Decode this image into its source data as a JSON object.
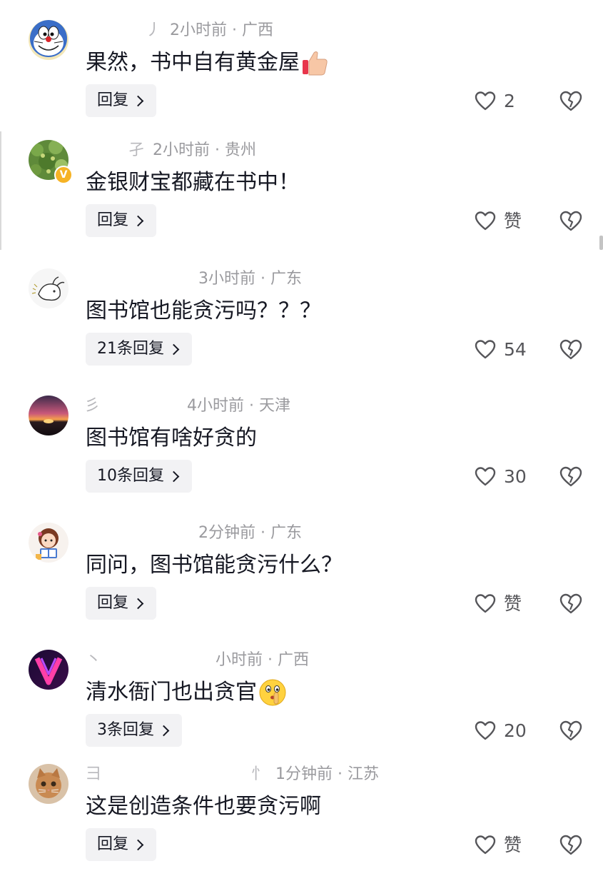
{
  "comments": [
    {
      "name": "",
      "name_fragment": "丿",
      "time": "2小时前",
      "location": "广西",
      "text": "果然，书中自有黄金屋",
      "emoji": "thumbs-up-emoji",
      "reply_label": "回复",
      "likes": "2",
      "avatar_icon": "cartoon-cat-avatar"
    },
    {
      "name": "",
      "name_fragment": "孑",
      "time": "2小时前",
      "location": "贵州",
      "text": "金银财宝都藏在书中！",
      "reply_label": "回复",
      "likes": "赞",
      "avatar_icon": "green-plant-avatar",
      "verified": "V"
    },
    {
      "name": "",
      "name_fragment": "",
      "time": "3小时前",
      "location": "广东",
      "text": "图书馆也能贪污吗？？？",
      "reply_label": "21条回复",
      "likes": "54",
      "avatar_icon": "sketch-animal-avatar"
    },
    {
      "name": "",
      "name_fragment": "彡",
      "time": "4小时前",
      "location": "天津",
      "text": "图书馆有啥好贪的",
      "reply_label": "10条回复",
      "likes": "30",
      "avatar_icon": "sunset-avatar"
    },
    {
      "name": "",
      "name_fragment": "",
      "time": "2分钟前",
      "location": "广东",
      "text": "同问，图书馆能贪污什么？",
      "reply_label": "回复",
      "likes": "赞",
      "avatar_icon": "reading-girl-avatar"
    },
    {
      "name": "",
      "name_fragment": "",
      "time": "小时前",
      "location": "广西",
      "text": "清水衙门也出贪官",
      "emoji": "shush-face-emoji",
      "reply_label": "3条回复",
      "likes": "20",
      "avatar_icon": "neon-v-avatar"
    },
    {
      "name": "",
      "name_fragment": "彐",
      "name_suffix": "忄",
      "time": "1分钟前",
      "location": "江苏",
      "text": "这是创造条件也要贪污啊",
      "reply_label": "回复",
      "likes": "赞",
      "avatar_icon": "kitten-avatar"
    }
  ],
  "icons": {
    "like": "heart-outline-icon",
    "dislike": "broken-heart-icon",
    "reply_chevron": "chevron-right-icon"
  },
  "separator": "·"
}
